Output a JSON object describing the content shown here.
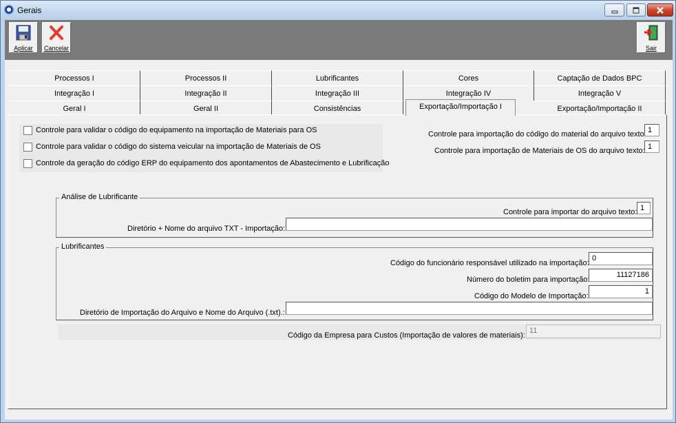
{
  "window": {
    "title": "Gerais",
    "min_label": "▭",
    "max_label": "□",
    "close_label": "✕"
  },
  "toolbar": {
    "apply_label": "Aplicar",
    "cancel_label": "Cancelar",
    "exit_label": "Sair"
  },
  "tabs": {
    "row1": [
      "Processos I",
      "Processos II",
      "Lubrificantes",
      "Cores",
      "Captação de Dados BPC"
    ],
    "row2": [
      "Integração I",
      "Integração II",
      "Integração III",
      "Integração IV",
      "Integração V"
    ],
    "row3": [
      "Geral I",
      "Geral II",
      "Consistências",
      "Exportação/Importação I",
      "Exportação/Importação II"
    ],
    "active": "Exportação/Importação I"
  },
  "checks": [
    "Controle para validar o código do equipamento na importação de Materiais para OS",
    "Controle para validar o código do sistema veicular na importação de Materiais de OS",
    "Controle da geração do código ERP do equipamento dos apontamentos de Abastecimento e Lubrificação"
  ],
  "controls": {
    "material_label": "Controle para importação do código do material do arquivo texto:",
    "material_value": "1",
    "materiais_os_label": "Controle para importação de Materiais de OS do arquivo texto:",
    "materiais_os_value": "1"
  },
  "analise": {
    "legend": "Análise de Lubrificante",
    "importar_label": "Controle para importar do arquivo texto:",
    "importar_value": "1",
    "dir_label": "Diretório + Nome do arquivo TXT - Importação:",
    "dir_value": ""
  },
  "lubrificantes": {
    "legend": "Lubrificantes",
    "func_label": "Código do funcionário responsável utilizado na importação:",
    "func_value": "0",
    "boletim_label": "Número do boletim para importação:",
    "boletim_value": "11127186",
    "modelo_label": "Código do Modelo de Importação:",
    "modelo_value": "1",
    "dir_label": "Diretório de Importação do Arquivo e Nome do Arquivo (.txt).:",
    "dir_value": ""
  },
  "empresa": {
    "label": "Código da Empresa para Custos (Importação de valores de materiais):",
    "value": "11"
  }
}
